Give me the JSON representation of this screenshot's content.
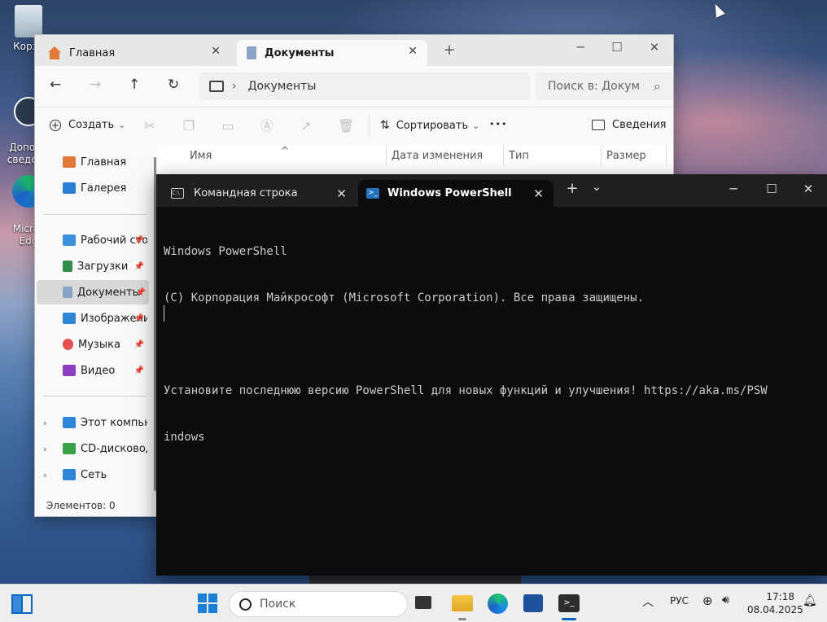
{
  "desktop": {
    "icons": [
      {
        "label": "Корзи"
      },
      {
        "label": "Дополн\nсведени"
      },
      {
        "label": "Micros\nEdg"
      }
    ]
  },
  "explorer": {
    "tabs": [
      {
        "label": "Главная",
        "close": "✕"
      },
      {
        "label": "Документы",
        "close": "✕"
      }
    ],
    "new_tab": "+",
    "window_controls": {
      "minimize": "─",
      "maximize": "☐",
      "close": "✕"
    },
    "nav": {
      "back": "←",
      "forward": "→",
      "up": "↑",
      "refresh": "↻"
    },
    "address": {
      "separator": "›",
      "location": "Документы"
    },
    "search": {
      "placeholder": "Поиск в: Докум",
      "icon": "⌕"
    },
    "toolbar": {
      "create_label": "Создать",
      "sort_label": "Сортировать",
      "more_label": "•••",
      "details_label": "Сведения",
      "dropdown": "⌄"
    },
    "sidebar": {
      "items": [
        {
          "label": "Главная",
          "color": "#e07a3a"
        },
        {
          "label": "Галерея",
          "color": "#2a7fd4"
        },
        {
          "label": "Рабочий сто",
          "color": "#3c8fd8",
          "pin": "📌"
        },
        {
          "label": "Загрузки",
          "color": "#2f8f4a",
          "pin": "📌"
        },
        {
          "label": "Документы",
          "color": "#8aa2c6",
          "pin": "📌"
        },
        {
          "label": "Изображени",
          "color": "#2f86d6",
          "pin": "📌"
        },
        {
          "label": "Музыка",
          "color": "#e3504e",
          "pin": "📌"
        },
        {
          "label": "Видео",
          "color": "#8b3fc0",
          "pin": "📌"
        },
        {
          "label": "Этот компьюте",
          "color": "#2f86d6",
          "chevron": "›"
        },
        {
          "label": "CD-дисковод (D",
          "color": "#3aa04a",
          "chevron": "›"
        },
        {
          "label": "Сеть",
          "color": "#2f86d6",
          "chevron": "›"
        }
      ]
    },
    "columns": [
      "Имя",
      "Дата изменения",
      "Тип",
      "Размер"
    ],
    "sort_indicator": "^",
    "status": "Элементов: 0"
  },
  "terminal": {
    "tabs": [
      {
        "label": "Командная строка",
        "close": "✕"
      },
      {
        "label": "Windows PowerShell",
        "close": "✕"
      }
    ],
    "new_tab": "+",
    "dropdown": "⌄",
    "window_controls": {
      "minimize": "─",
      "maximize": "☐",
      "close": "✕"
    },
    "lines": [
      "Windows PowerShell",
      "(C) Корпорация Майкрософт (Microsoft Corporation). Все права защищены.",
      "",
      "Установите последнюю версию PowerShell для новых функций и улучшения! https://aka.ms/PSW",
      "indows"
    ]
  },
  "taskbar": {
    "search_placeholder": "Поиск",
    "tray_chevron": "︿",
    "language": "РУС",
    "time": "17:18",
    "date": "08.04.2025"
  },
  "colors": {
    "accent": "#0067c0",
    "terminal_bg": "#0c0c0c",
    "terminal_text": "#cccccc"
  }
}
